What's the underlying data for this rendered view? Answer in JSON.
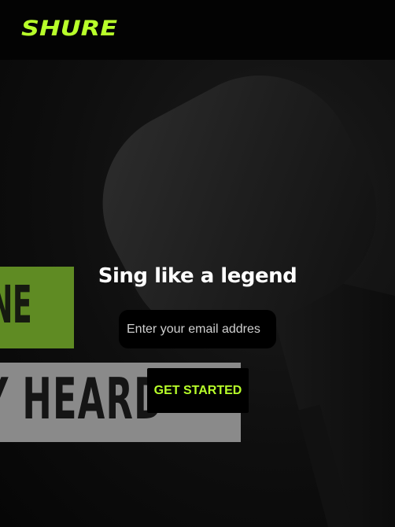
{
  "header": {
    "brand": "SHURE"
  },
  "hero": {
    "headline": "Sing like a legend",
    "email_placeholder": "Enter your email addres",
    "cta_label": "GET STARTED",
    "banner_green_text": "NE",
    "banner_grey_text": "Y HEARD"
  },
  "colors": {
    "brand_accent": "#b8ff2a",
    "background": "#000000",
    "banner_green": "#5f8b23",
    "banner_grey": "#8a8a8a"
  }
}
